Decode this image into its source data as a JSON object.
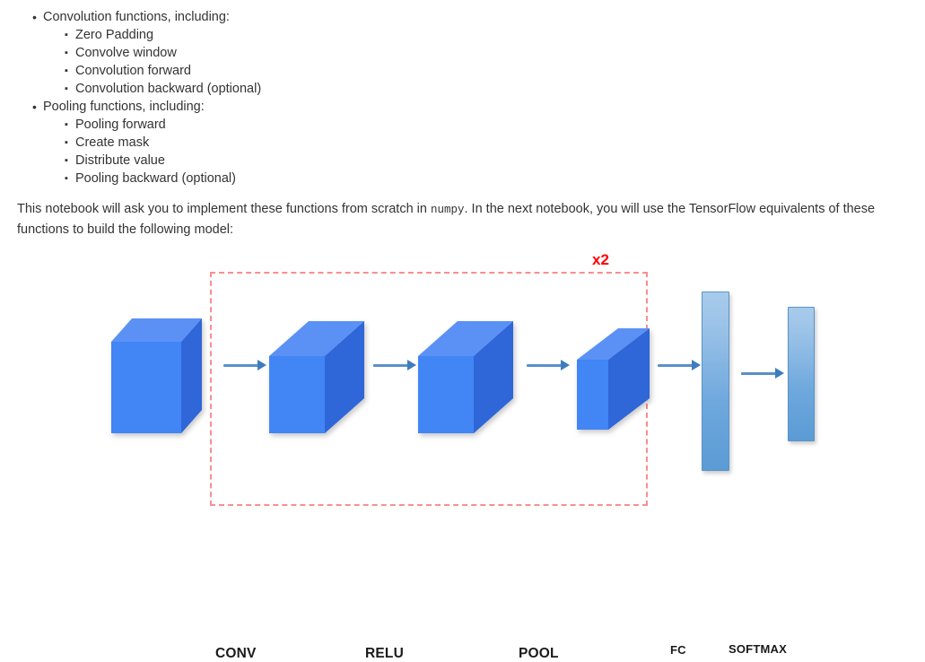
{
  "document": {
    "lists": [
      {
        "label": "Convolution functions, including:",
        "sub_items": [
          "Zero Padding",
          "Convolve window",
          "Convolution forward",
          "Convolution backward (optional)"
        ]
      },
      {
        "label": "Pooling functions, including:",
        "sub_items": [
          "Pooling forward",
          "Create mask",
          "Distribute value",
          "Pooling backward (optional)"
        ]
      }
    ],
    "paragraph": {
      "part1": "This notebook will ask you to implement these functions from scratch in ",
      "code": "numpy",
      "part2": ". In the next notebook, you will use the TensorFlow equivalents of these functions to build the following model:"
    }
  },
  "diagram": {
    "repeat_badge": "x2",
    "operations": [
      {
        "id": "conv",
        "label": "CONV"
      },
      {
        "id": "relu",
        "label": "RELU"
      },
      {
        "id": "pool",
        "label": "POOL"
      },
      {
        "id": "fc",
        "label": "FC"
      },
      {
        "id": "softmax",
        "label": "SOFTMAX"
      }
    ],
    "colors": {
      "cube_front": "#4285F4",
      "cube_top": "#5B91F5",
      "cube_side": "#2F66D8",
      "bar_top": "#A7CBEB",
      "bar_bottom": "#5B9BD5",
      "arrow": "#5B8FC9",
      "dashed_border": "#F98E8E",
      "badge_text": "#FF0000"
    },
    "blocks": [
      {
        "id": "input-volume",
        "kind": "cube"
      },
      {
        "id": "conv-output-volume",
        "kind": "cube"
      },
      {
        "id": "relu-output-volume",
        "kind": "cube"
      },
      {
        "id": "pool-output-volume",
        "kind": "cube"
      },
      {
        "id": "fc-vector",
        "kind": "bar"
      },
      {
        "id": "softmax-vector",
        "kind": "bar"
      }
    ]
  }
}
